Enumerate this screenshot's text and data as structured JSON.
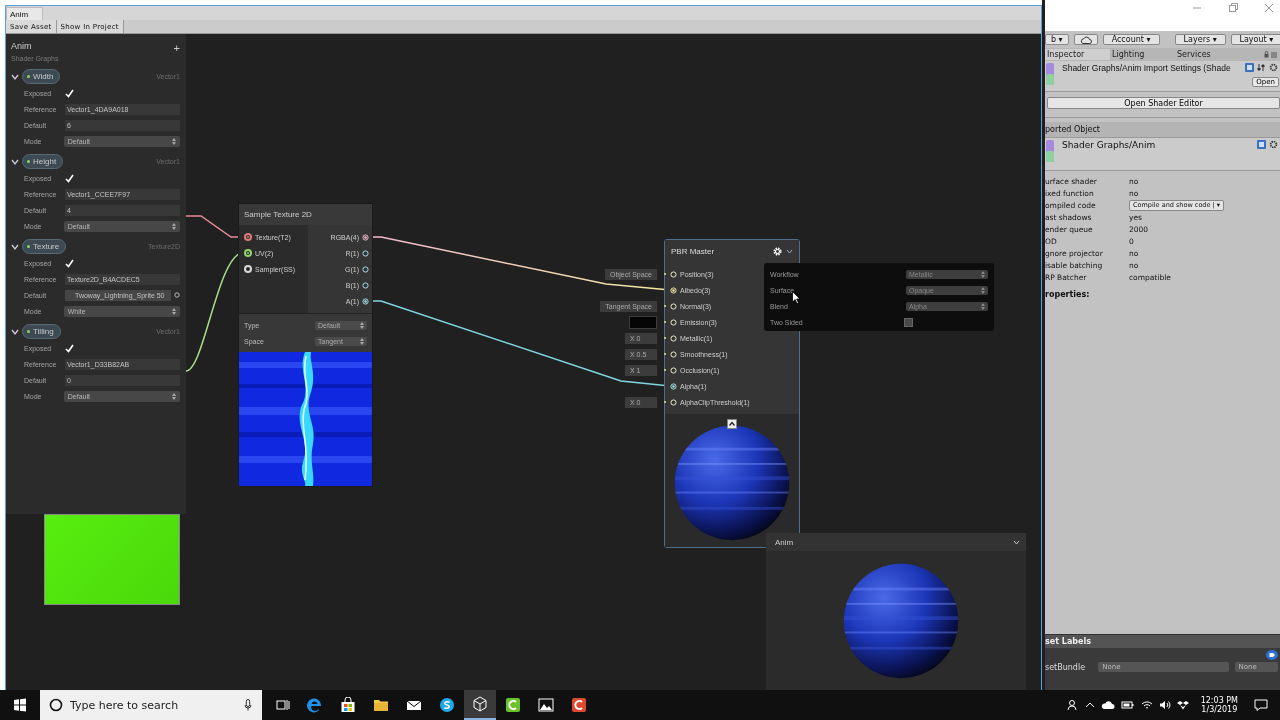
{
  "graph_window": {
    "tab": "Anim",
    "toolbar": [
      "Save Asset",
      "Show In Project"
    ]
  },
  "blackboard": {
    "title": "Anim",
    "subtitle": "Shader Graphs",
    "add": "+",
    "properties": [
      {
        "name": "Width",
        "type": "Vector1",
        "expanded": true,
        "fields": [
          {
            "label": "Exposed",
            "kind": "checkbox",
            "checked": true
          },
          {
            "label": "Reference",
            "kind": "text",
            "value": "Vector1_4DA9A018"
          },
          {
            "label": "Default",
            "kind": "text",
            "value": "6"
          },
          {
            "label": "Mode",
            "kind": "dropdown",
            "value": "Default"
          }
        ]
      },
      {
        "name": "Height",
        "type": "Vector1",
        "expanded": true,
        "fields": [
          {
            "label": "Exposed",
            "kind": "checkbox",
            "checked": true
          },
          {
            "label": "Reference",
            "kind": "text",
            "value": "Vector1_CCEE7F97"
          },
          {
            "label": "Default",
            "kind": "text",
            "value": "4"
          },
          {
            "label": "Mode",
            "kind": "dropdown",
            "value": "Default"
          }
        ]
      },
      {
        "name": "Texture",
        "type": "Texture2D",
        "expanded": true,
        "fields": [
          {
            "label": "Exposed",
            "kind": "checkbox",
            "checked": true
          },
          {
            "label": "Reference",
            "kind": "text",
            "value": "Texture2D_B4ACDEC5"
          },
          {
            "label": "Default",
            "kind": "texture",
            "value": "Twoway_Lightning_Sprite 50"
          },
          {
            "label": "Mode",
            "kind": "dropdown",
            "value": "White"
          }
        ]
      },
      {
        "name": "Tilling",
        "type": "Vector1",
        "expanded": true,
        "fields": [
          {
            "label": "Exposed",
            "kind": "checkbox",
            "checked": true
          },
          {
            "label": "Reference",
            "kind": "text",
            "value": "Vector1_D33B82AB"
          },
          {
            "label": "Default",
            "kind": "text",
            "value": "0"
          },
          {
            "label": "Mode",
            "kind": "dropdown",
            "value": "Default"
          }
        ]
      }
    ]
  },
  "sample_node": {
    "title": "Sample Texture 2D",
    "inputs": [
      {
        "label": "Texture(T2)",
        "color": "#e07a7a",
        "connected": true
      },
      {
        "label": "UV(2)",
        "color": "#8fd46e",
        "connected": true
      },
      {
        "label": "Sampler(SS)",
        "color": "#d8d8d8",
        "connected": false
      }
    ],
    "outputs": [
      {
        "label": "RGBA(4)",
        "connected": true
      },
      {
        "label": "R(1)",
        "connected": false
      },
      {
        "label": "G(1)",
        "connected": false
      },
      {
        "label": "B(1)",
        "connected": false
      },
      {
        "label": "A(1)",
        "connected": true
      }
    ],
    "settings": [
      {
        "label": "Type",
        "value": "Default"
      },
      {
        "label": "Space",
        "value": "Tangent"
      }
    ]
  },
  "master_node": {
    "title": "PBR Master",
    "ports": [
      {
        "label": "Position(3)",
        "kind": "space",
        "value": "Object Space",
        "connected": false
      },
      {
        "label": "Albedo(3)",
        "kind": "none",
        "connected": true
      },
      {
        "label": "Normal(3)",
        "kind": "space",
        "value": "Tangent Space",
        "connected": false
      },
      {
        "label": "Emission(3)",
        "kind": "swatch",
        "connected": false
      },
      {
        "label": "Metallic(1)",
        "kind": "number",
        "value": "X 0",
        "connected": false
      },
      {
        "label": "Smoothness(1)",
        "kind": "number",
        "value": "X 0.5",
        "connected": false
      },
      {
        "label": "Occlusion(1)",
        "kind": "number",
        "value": "X 1",
        "connected": false
      },
      {
        "label": "Alpha(1)",
        "kind": "none",
        "connected": true
      },
      {
        "label": "AlphaClipThreshold(1)",
        "kind": "number",
        "value": "X 0",
        "connected": false
      }
    ]
  },
  "settings_popup": {
    "rows": [
      {
        "label": "Workflow",
        "kind": "dropdown",
        "value": "Metallic"
      },
      {
        "label": "Surface",
        "kind": "dropdown",
        "value": "Opaque"
      },
      {
        "label": "Blend",
        "kind": "dropdown",
        "value": "Alpha"
      },
      {
        "label": "Two Sided",
        "kind": "checkbox",
        "checked": false
      }
    ]
  },
  "preview": {
    "title": "Anim"
  },
  "inspector": {
    "toolbar": [
      {
        "label": "b ▾",
        "kind": "button"
      },
      {
        "kind": "cloud"
      },
      {
        "label": "Account ▾",
        "kind": "button"
      },
      {
        "label": "Layers ▾",
        "kind": "button"
      },
      {
        "label": "Layout ▾",
        "kind": "button"
      }
    ],
    "tabs": [
      {
        "label": "Inspector",
        "selected": true
      },
      {
        "label": "Lighting",
        "selected": false
      },
      {
        "label": "Services",
        "selected": false
      }
    ],
    "header": "Shader Graphs/Anim Import Settings (Shade",
    "open": "Open",
    "open_editor": "Open Shader Editor",
    "section": "ported Object",
    "object": "Shader Graphs/Anim",
    "rows": [
      {
        "label": "urface shader",
        "value": "no",
        "kind": "text"
      },
      {
        "label": "ixed function",
        "value": "no",
        "kind": "text"
      },
      {
        "label": "ompiled code",
        "value": "Compile and show code | ▾",
        "kind": "dropdown"
      },
      {
        "label": "ast shadows",
        "value": "yes",
        "kind": "text"
      },
      {
        "label": "ender queue",
        "value": "2000",
        "kind": "text"
      },
      {
        "label": "OD",
        "value": "0",
        "kind": "text"
      },
      {
        "label": "gnore projector",
        "value": "no",
        "kind": "text"
      },
      {
        "label": "isable batching",
        "value": "no",
        "kind": "text"
      },
      {
        "label": "RP Batcher",
        "value": "compatible",
        "kind": "text"
      }
    ],
    "properties": "roperties:",
    "labels": "set Labels",
    "bundle": "setBundle",
    "bundle_values": [
      "None",
      "None"
    ]
  },
  "taskbar": {
    "search_placeholder": "Type here to search",
    "time": "12:03 PM",
    "date": "1/3/2019"
  }
}
